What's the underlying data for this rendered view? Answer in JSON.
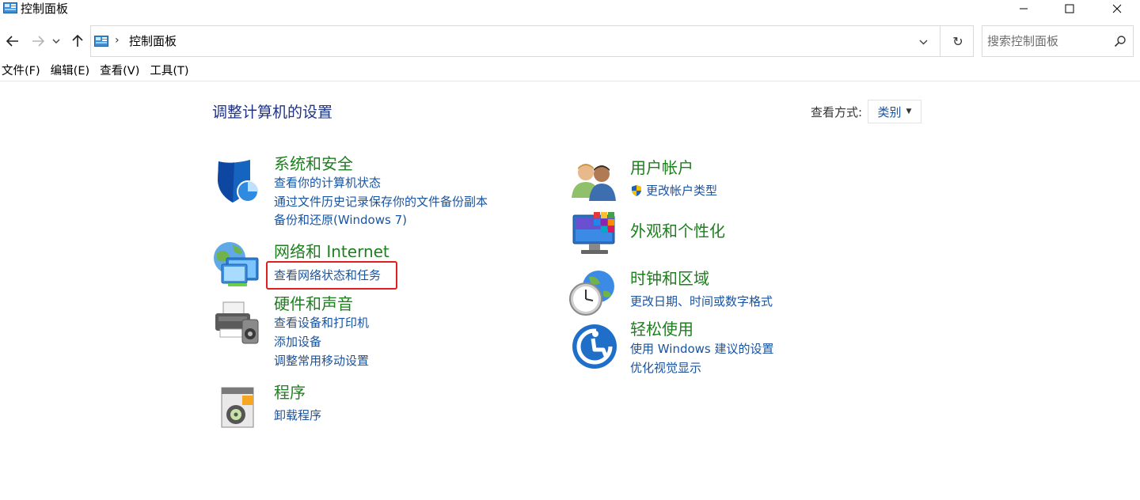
{
  "window": {
    "title": "控制面板"
  },
  "address": {
    "separator": "›",
    "breadcrumb": "控制面板",
    "refresh_glyph": "↻"
  },
  "search": {
    "placeholder": "搜索控制面板"
  },
  "menubar": {
    "items": [
      "文件(F)",
      "编辑(E)",
      "查看(V)",
      "工具(T)"
    ]
  },
  "main": {
    "heading": "调整计算机的设置",
    "view_by_label": "查看方式:",
    "view_by_value": "类别",
    "categories": [
      {
        "title": "系统和安全",
        "icon": "shield-icon",
        "links": [
          "查看你的计算机状态",
          "通过文件历史记录保存你的文件备份副本",
          "备份和还原(Windows 7)"
        ]
      },
      {
        "title": "网络和 Internet",
        "icon": "network-icon",
        "links": [
          "查看网络状态和任务"
        ]
      },
      {
        "title": "硬件和声音",
        "icon": "printer-icon",
        "links": [
          "查看设备和打印机",
          "添加设备",
          "调整常用移动设置"
        ]
      },
      {
        "title": "程序",
        "icon": "programs-icon",
        "links": [
          "卸载程序"
        ]
      },
      {
        "title": "用户帐户",
        "icon": "users-icon",
        "links": [
          "更改帐户类型"
        ]
      },
      {
        "title": "外观和个性化",
        "icon": "monitor-icon",
        "links": []
      },
      {
        "title": "时钟和区域",
        "icon": "clock-globe-icon",
        "links": [
          "更改日期、时间或数字格式"
        ]
      },
      {
        "title": "轻松使用",
        "icon": "accessibility-icon",
        "links": [
          "使用 Windows 建议的设置",
          "优化视觉显示"
        ]
      }
    ]
  },
  "colors": {
    "category_title": "#1d7f1d",
    "link": "#1a53a0",
    "heading": "#1e3287",
    "highlight_border": "#e02020"
  }
}
